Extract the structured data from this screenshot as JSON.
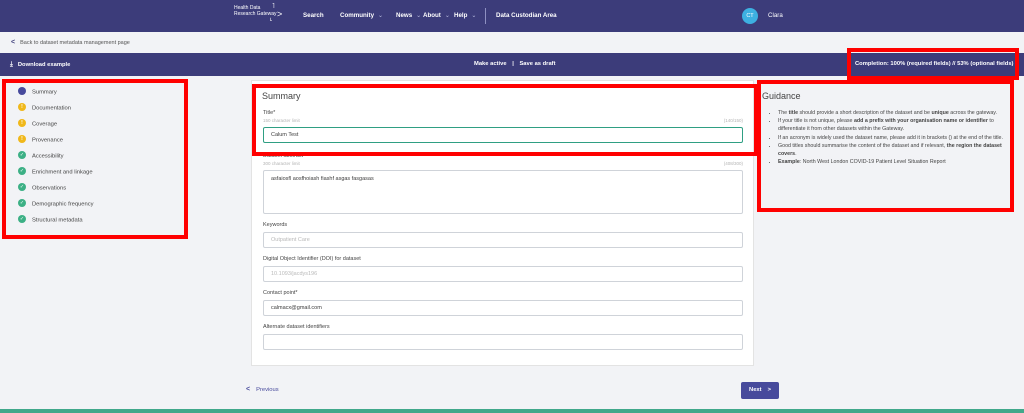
{
  "nav": {
    "logo_line1": "Health Data",
    "logo_line2": "Research Gateway",
    "items": [
      {
        "label": "Search",
        "caret": false
      },
      {
        "label": "Community",
        "caret": true
      },
      {
        "label": "News",
        "caret": true
      },
      {
        "label": "About",
        "caret": true
      },
      {
        "label": "Help",
        "caret": true
      }
    ],
    "area": "Data Custodian Area",
    "avatar_initials": "CT",
    "user_name": "Clara"
  },
  "back_link": "Back to dataset metadata management page",
  "action_bar": {
    "download": "Download example",
    "make_active": "Make active",
    "separator": "|",
    "save_draft": "Save as draft",
    "completion": "Completion: 100% (required fields) // 53% (optional fields)"
  },
  "sidebar": {
    "items": [
      {
        "label": "Summary",
        "status": "current"
      },
      {
        "label": "Documentation",
        "status": "warning"
      },
      {
        "label": "Coverage",
        "status": "warning"
      },
      {
        "label": "Provenance",
        "status": "warning"
      },
      {
        "label": "Accessibility",
        "status": "done"
      },
      {
        "label": "Enrichment and linkage",
        "status": "done"
      },
      {
        "label": "Observations",
        "status": "done"
      },
      {
        "label": "Demographic frequency",
        "status": "done"
      },
      {
        "label": "Structural metadata",
        "status": "done"
      }
    ]
  },
  "form": {
    "title": "Summary",
    "title_field": {
      "label": "Title*",
      "hint": "150 character limit",
      "count": "(140/150)",
      "value": "Calum Test"
    },
    "abstract_field": {
      "label": "Dataset abstract*",
      "hint": "300 character limit",
      "count": "(408/300)",
      "value": "asfaiosfl aosfhoiash fiashf asgas fasgasas"
    },
    "keywords_field": {
      "label": "Keywords",
      "placeholder": "Outpatient Care"
    },
    "doi_field": {
      "label": "Digital Object Identifier (DOI) for dataset",
      "placeholder": "10.1093/jacdys196"
    },
    "contact_field": {
      "label": "Contact point*",
      "value": "calmacx@gmail.com"
    },
    "alt_ids_field": {
      "label": "Alternate dataset identifiers",
      "value": ""
    }
  },
  "guidance": {
    "title": "Guidance",
    "bullet1": {
      "a": "The ",
      "b": "title",
      "c": " should provide a short description of the dataset and be ",
      "d": "unique",
      "e": " across the gateway."
    },
    "bullet2": {
      "a": "If your title is not unique, please ",
      "b": "add a prefix with your organisation name or identifier",
      "c": " to differentiate it from other datasets within the Gateway."
    },
    "bullet3": "If an acronym is widely used the dataset name, please add it in brackets () at the end of the title.",
    "bullet4": {
      "a": "Good titles should summarise the content of the dataset and if relevant, ",
      "b": "the region the dataset covers",
      "c": "."
    },
    "bullet5": {
      "a": "Example",
      "b": ": North West London COVID-19 Patient Level Situation Report"
    }
  },
  "footer": {
    "previous": "Previous",
    "next": "Next"
  },
  "icons": {
    "logo_caret": ">",
    "back_arrow": "<",
    "download_icon": "⤓",
    "prev_arrow": "<",
    "next_arrow": ">",
    "check_glyph": "✓",
    "warning_glyph": "!",
    "caret_glyph": "⌄"
  }
}
